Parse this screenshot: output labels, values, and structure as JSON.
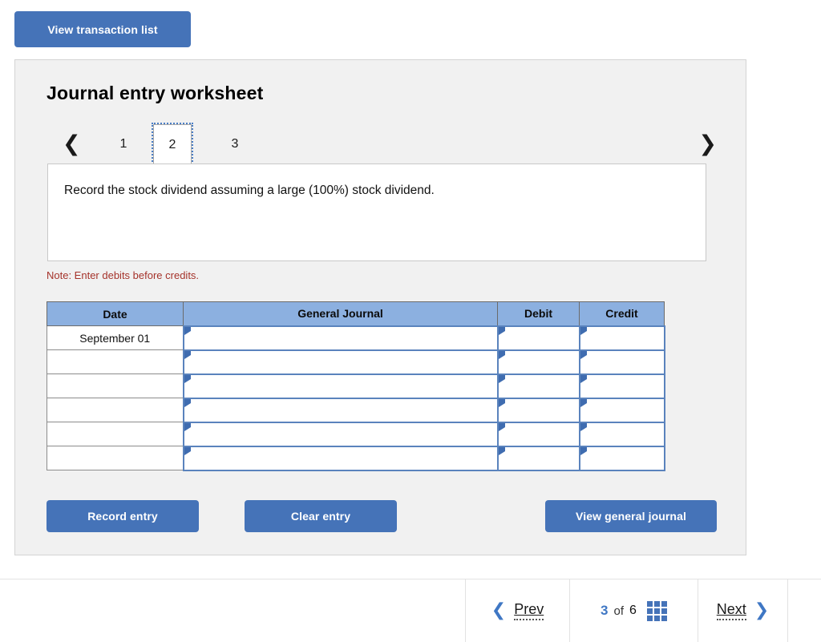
{
  "toolbar": {
    "view_transaction_list_label": "View transaction list"
  },
  "panel": {
    "title": "Journal entry worksheet",
    "tabs": {
      "prev_icon": "chevron-left-icon",
      "next_icon": "chevron-right-icon",
      "items": [
        {
          "label": "1",
          "active": false
        },
        {
          "label": "2",
          "active": true
        },
        {
          "label": "3",
          "active": false
        }
      ]
    },
    "instruction": "Record the stock dividend assuming a large (100%) stock dividend.",
    "note": "Note: Enter debits before credits."
  },
  "table": {
    "headers": [
      "Date",
      "General Journal",
      "Debit",
      "Credit"
    ],
    "rows": [
      {
        "date": "September 01",
        "general_journal": "",
        "debit": "",
        "credit": ""
      },
      {
        "date": "",
        "general_journal": "",
        "debit": "",
        "credit": ""
      },
      {
        "date": "",
        "general_journal": "",
        "debit": "",
        "credit": ""
      },
      {
        "date": "",
        "general_journal": "",
        "debit": "",
        "credit": ""
      },
      {
        "date": "",
        "general_journal": "",
        "debit": "",
        "credit": ""
      },
      {
        "date": "",
        "general_journal": "",
        "debit": "",
        "credit": ""
      }
    ]
  },
  "actions": {
    "record_entry_label": "Record entry",
    "clear_entry_label": "Clear entry",
    "view_general_journal_label": "View general journal"
  },
  "footer": {
    "prev_label": "Prev",
    "prev_icon": "chevron-left-icon",
    "current_page": "3",
    "of_label": "of",
    "total_pages": "6",
    "grid_icon": "grid-view-icon",
    "next_label": "Next",
    "next_icon": "chevron-right-icon"
  },
  "colors": {
    "brand_blue": "#4573b8",
    "header_blue": "#8cb0e0",
    "cell_border_blue": "#5a83bd",
    "note_red": "#a5332b",
    "panel_bg": "#f1f1f1"
  }
}
